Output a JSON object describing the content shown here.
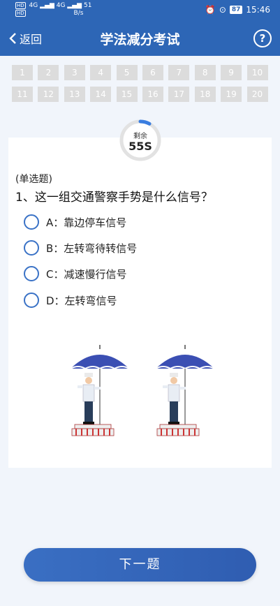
{
  "status_bar": {
    "network_1": "4G",
    "network_2": "4G",
    "speed_value": "51",
    "speed_unit": "B/s",
    "battery": "87",
    "time": "15:46"
  },
  "navbar": {
    "back_label": "返回",
    "title": "学法减分考试",
    "help_icon": "?"
  },
  "question_numbers": [
    "1",
    "2",
    "3",
    "4",
    "5",
    "6",
    "7",
    "8",
    "9",
    "10",
    "11",
    "12",
    "13",
    "14",
    "15",
    "16",
    "17",
    "18",
    "19",
    "20"
  ],
  "timer": {
    "label": "剩余",
    "value": "55S",
    "progress": 0.08
  },
  "question": {
    "type": "(单选题)",
    "text": "1、这一组交通警察手势是什么信号？"
  },
  "options": [
    {
      "text": "A：靠边停车信号"
    },
    {
      "text": "B：左转弯待转信号"
    },
    {
      "text": "C：减速慢行信号"
    },
    {
      "text": "D：左转弯信号"
    }
  ],
  "next_button": "下一题",
  "colors": {
    "primary": "#2d66b6",
    "radio": "#3a72c6",
    "grid_cell": "#dcdcdc",
    "background": "#f1f5fb"
  }
}
